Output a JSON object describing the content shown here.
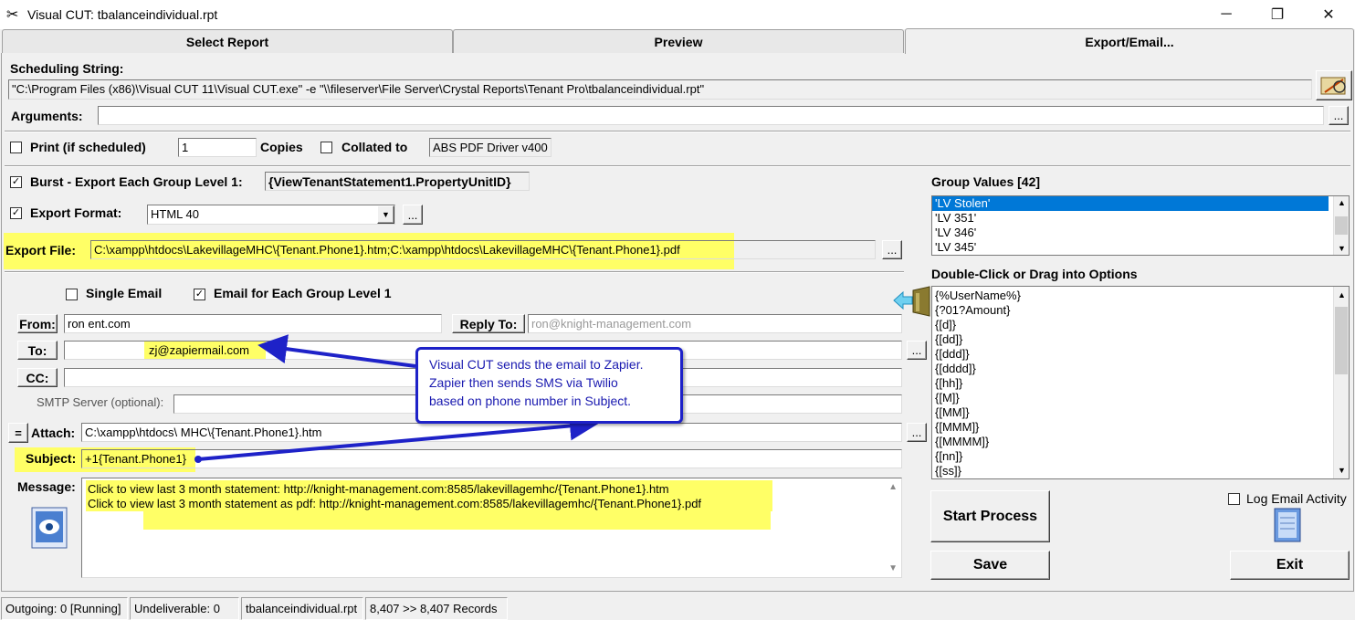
{
  "window": {
    "title": "Visual CUT:  tbalanceindividual.rpt",
    "min": "─",
    "restore": "❐",
    "close": "✕"
  },
  "tabs": [
    "Select Report",
    "Preview",
    "Export/Email..."
  ],
  "scheduling": {
    "label": "Scheduling String:",
    "value": "\"C:\\Program Files (x86)\\Visual CUT 11\\Visual CUT.exe\" -e \"\\\\fileserver\\File Server\\Crystal Reports\\Tenant Pro\\tbalanceindividual.rpt\""
  },
  "arguments": {
    "label": "Arguments:",
    "value": "",
    "btn": "..."
  },
  "print": {
    "label": "Print (if scheduled)",
    "copies_value": "1",
    "copies_label": "Copies",
    "collated_label": "Collated to",
    "printer": "ABS PDF Driver v400"
  },
  "burst": {
    "label": "Burst - Export Each Group Level 1:",
    "field": "{ViewTenantStatement1.PropertyUnitID}"
  },
  "export_format": {
    "label": "Export Format:",
    "value": "HTML 40",
    "btn": "..."
  },
  "export_file": {
    "label": "Export File:",
    "value": "C:\\xampp\\htdocs\\LakevillageMHC\\{Tenant.Phone1}.htm;C:\\xampp\\htdocs\\LakevillageMHC\\{Tenant.Phone1}.pdf",
    "btn": "..."
  },
  "email_opts": {
    "single": "Single Email",
    "each": "Email for Each Group Level 1"
  },
  "from": {
    "label": "From:",
    "value": "ron                         ent.com"
  },
  "reply_to": {
    "label": "Reply To:",
    "value": "ron@knight-management.com"
  },
  "to": {
    "label": "To:",
    "value": "zj@zapiermail.com",
    "btn": "..."
  },
  "cc": {
    "label": "CC:",
    "value": ""
  },
  "smtp": {
    "label": "SMTP Server (optional):",
    "value": ""
  },
  "attach": {
    "eq": "=",
    "label": "Attach:",
    "value": "C:\\xampp\\htdocs\\                MHC\\{Tenant.Phone1}.htm",
    "btn": "..."
  },
  "subject": {
    "label": "Subject:",
    "value": "+1{Tenant.Phone1}"
  },
  "message": {
    "label": "Message:",
    "lines": [
      "Click to view last 3 month statement: http://knight-management.com:8585/lakevillagemhc/{Tenant.Phone1}.htm",
      "Click to view last 3 month statement as pdf: http://knight-management.com:8585/lakevillagemhc/{Tenant.Phone1}.pdf"
    ]
  },
  "callout": {
    "lines": [
      "Visual CUT sends the email to Zapier.",
      "Zapier then sends SMS via Twilio",
      "based on phone number in Subject."
    ]
  },
  "group_values": {
    "label": "Group Values [42]",
    "items": [
      "'LV Stolen'",
      "'LV 351'",
      "'LV 346'",
      "'LV 345'"
    ]
  },
  "options": {
    "label": "Double-Click or Drag into Options",
    "items": [
      "{%UserName%}",
      "{?01?Amount}",
      "{[d]}",
      "{[dd]}",
      "{[ddd]}",
      "{[dddd]}",
      "{[hh]}",
      "{[M]}",
      "{[MM]}",
      "{[MMM]}",
      "{[MMMM]}",
      "{[nn]}",
      "{[ss]}"
    ]
  },
  "log_email": {
    "label": "Log Email Activity"
  },
  "buttons": {
    "start": "Start Process",
    "save": "Save",
    "exit": "Exit"
  },
  "status": [
    "Outgoing: 0 [Running]",
    "Undeliverable: 0",
    "tbalanceindividual.rpt",
    "8,407 >> 8,407 Records"
  ],
  "colors": {
    "highlight": "#ffff66",
    "callout_border": "#1e22c8",
    "selection": "#0078d7"
  }
}
